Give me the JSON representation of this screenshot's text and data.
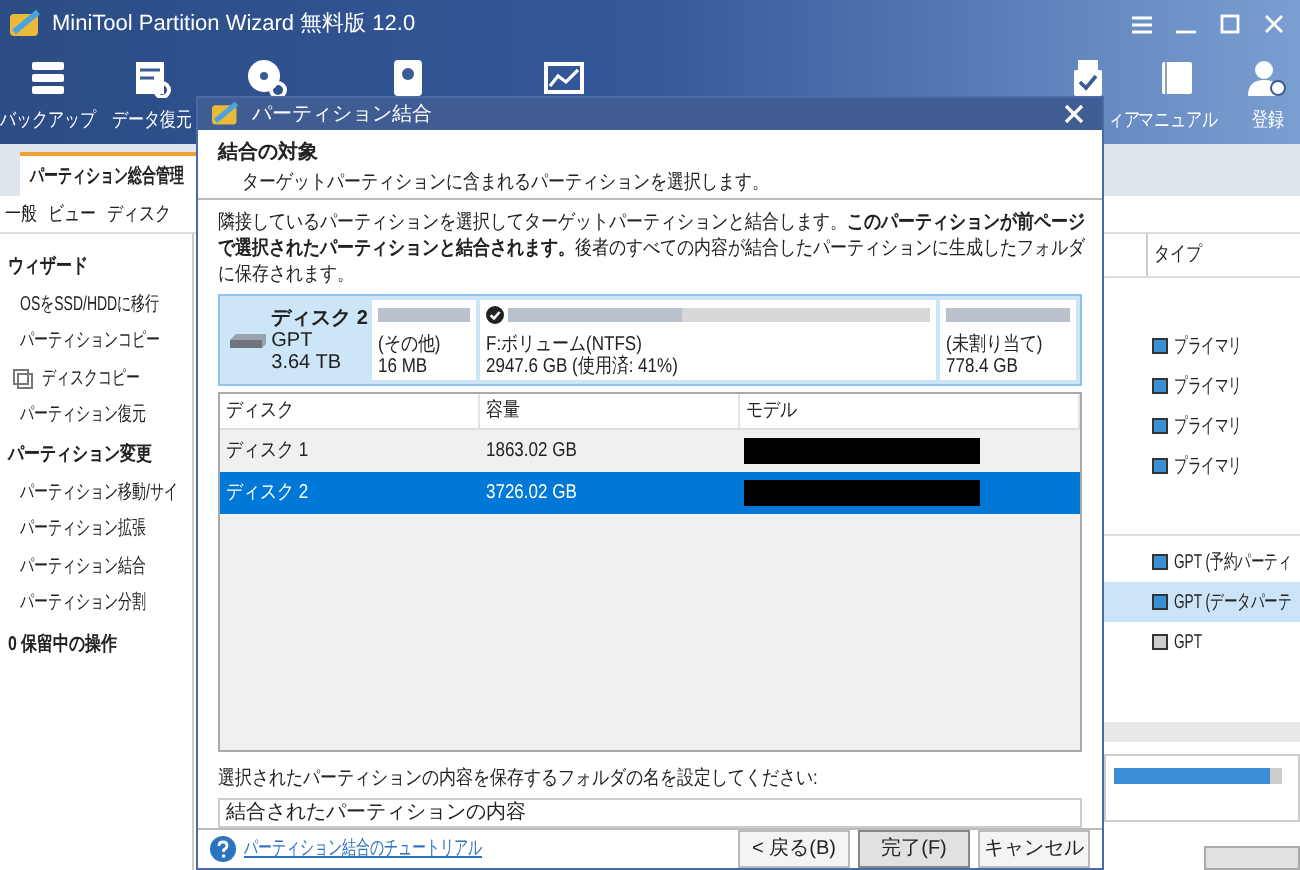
{
  "window": {
    "title": "MiniTool Partition Wizard 無料版 12.0"
  },
  "toolbar": {
    "left": [
      {
        "kind": "stack",
        "label": "バックアップ"
      },
      {
        "kind": "doc-restore",
        "label": "データ復元"
      },
      {
        "kind": "disk-restore"
      },
      {
        "kind": "disk"
      },
      {
        "kind": "chart"
      }
    ],
    "right": [
      {
        "kind": "usb",
        "label": "ィア"
      },
      {
        "kind": "book",
        "label": "マニュアル"
      },
      {
        "kind": "user",
        "label": "登録"
      }
    ]
  },
  "main_tab": {
    "label": "パーティション総合管理",
    "selected": true
  },
  "menu": [
    "一般",
    "ビュー",
    "ディスク"
  ],
  "sidebar": {
    "sections": [
      {
        "title": "ウィザード",
        "items": [
          "OSをSSD/HDDに移行",
          "パーティションコピー",
          "ディスクコピー",
          "パーティション復元"
        ]
      },
      {
        "title": "パーティション変更",
        "items": [
          "パーティション移動/サイ",
          "パーティション拡張",
          "パーティション結合",
          "パーティション分割"
        ]
      }
    ],
    "pending": "0 保留中の操作"
  },
  "partition_list": {
    "column": "タイプ",
    "groups": [
      {
        "rows": [
          {
            "type": "プライマリ",
            "color": "#3b8fd4",
            "selected": false
          },
          {
            "type": "プライマリ",
            "color": "#3b8fd4",
            "selected": false
          },
          {
            "type": "プライマリ",
            "color": "#3b8fd4",
            "selected": false
          },
          {
            "type": "プライマリ",
            "color": "#3b8fd4",
            "selected": false
          }
        ]
      },
      {
        "rows": [
          {
            "type": "GPT (予約パーティ",
            "color": "#3b8fd4",
            "selected": false
          },
          {
            "type": "GPT (データパーテ",
            "color": "#3b8fd4",
            "selected": true
          },
          {
            "type": "GPT",
            "color": "#cccccc",
            "selected": false
          }
        ]
      }
    ]
  },
  "disk_bar": {
    "level": 0.93
  },
  "dialog": {
    "title": "パーティション結合",
    "header": {
      "title": "結合の対象",
      "subtitle": "ターゲットパーティションに含まれるパーティションを選択します。"
    },
    "description": "隣接しているパーティションを選択してターゲットパーティションと結合します。**このパーティションが前ページで選択されたパーティションと結合されます。**後者のすべての内容が結合したパーティションに生成したフォルダに保存されます。",
    "disk_map": {
      "disk": {
        "name": "ディスク 2",
        "scheme": "GPT",
        "size": "3.64 TB"
      },
      "partitions": [
        {
          "name": "(その他)",
          "size": "16 MB",
          "level": 1,
          "checked": false
        },
        {
          "name": "F:ボリューム(NTFS)",
          "size": "2947.6 GB (使用済: 41%)",
          "level": 0.41,
          "checked": true
        },
        {
          "name": "(未割り当て)",
          "size": "778.4 GB",
          "level": 1,
          "checked": false
        }
      ]
    },
    "table": {
      "columns": [
        "ディスク",
        "容量",
        "モデル"
      ],
      "rows": [
        {
          "disk": "ディスク 1",
          "capacity": "1863.02 GB",
          "model_redacted": true,
          "selected": false
        },
        {
          "disk": "ディスク 2",
          "capacity": "3726.02 GB",
          "model_redacted": true,
          "selected": true
        }
      ]
    },
    "folder_label": "選択されたパーティションの内容を保存するフォルダの名を設定してください:",
    "folder_value": "結合されたパーティションの内容",
    "tutorial_link": "パーティション結合のチュートリアル",
    "buttons": [
      {
        "label": "< 戻る(B)",
        "default": false
      },
      {
        "label": "完了(F)",
        "default": true
      },
      {
        "label": "キャンセル",
        "default": false
      }
    ]
  }
}
